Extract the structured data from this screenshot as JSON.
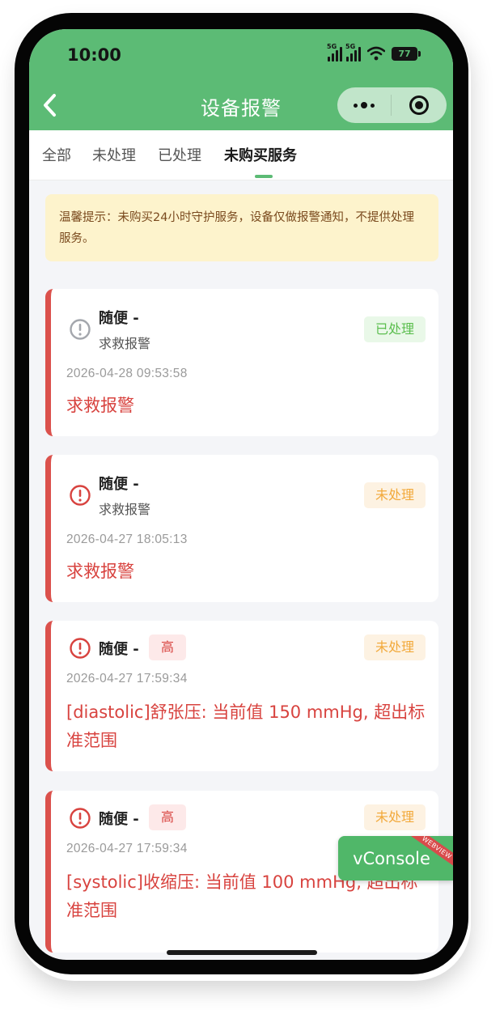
{
  "status_bar": {
    "time": "10:00",
    "signal_tag": "5G",
    "battery": "77"
  },
  "nav": {
    "title": "设备报警"
  },
  "tabs": [
    {
      "label": "全部",
      "active": false
    },
    {
      "label": "未处理",
      "active": false
    },
    {
      "label": "已处理",
      "active": false
    },
    {
      "label": "未购买服务",
      "active": true
    }
  ],
  "notice": {
    "text": "温馨提示：未购买24小时守护服务，设备仅做报警通知，不提供处理服务。"
  },
  "alarms": [
    {
      "name": "随便 -",
      "type_label": "求救报警",
      "status": "已处理",
      "time": "2026-04-28 09:53:58",
      "description": "求救报警",
      "icon": "alert-circle-icon-gray"
    },
    {
      "name": "随便 -",
      "type_label": "求救报警",
      "status": "未处理",
      "time": "2026-04-27 18:05:13",
      "description": "求救报警",
      "icon": "alert-circle-icon-red"
    },
    {
      "name": "随便 -",
      "level": "高",
      "status": "未处理",
      "time": "2026-04-27 17:59:34",
      "description": "[diastolic]舒张压: 当前值 150 mmHg, 超出标准范围",
      "icon": "alert-circle-icon-red"
    },
    {
      "name": "随便 -",
      "level": "高",
      "status": "未处理",
      "time": "2026-04-27 17:59:34",
      "description": "[systolic]收缩压: 当前值 100 mmHg, 超出标准范围",
      "icon": "alert-circle-icon-red"
    }
  ],
  "vconsole": {
    "label": "vConsole",
    "ribbon": "WEBVIEW"
  },
  "colors": {
    "brand_green": "#5cbb75",
    "alert_red": "#db514c",
    "done_green": "#5bbe4e",
    "pending_orange": "#f2a93b",
    "notice_bg": "#fdf3cc"
  }
}
